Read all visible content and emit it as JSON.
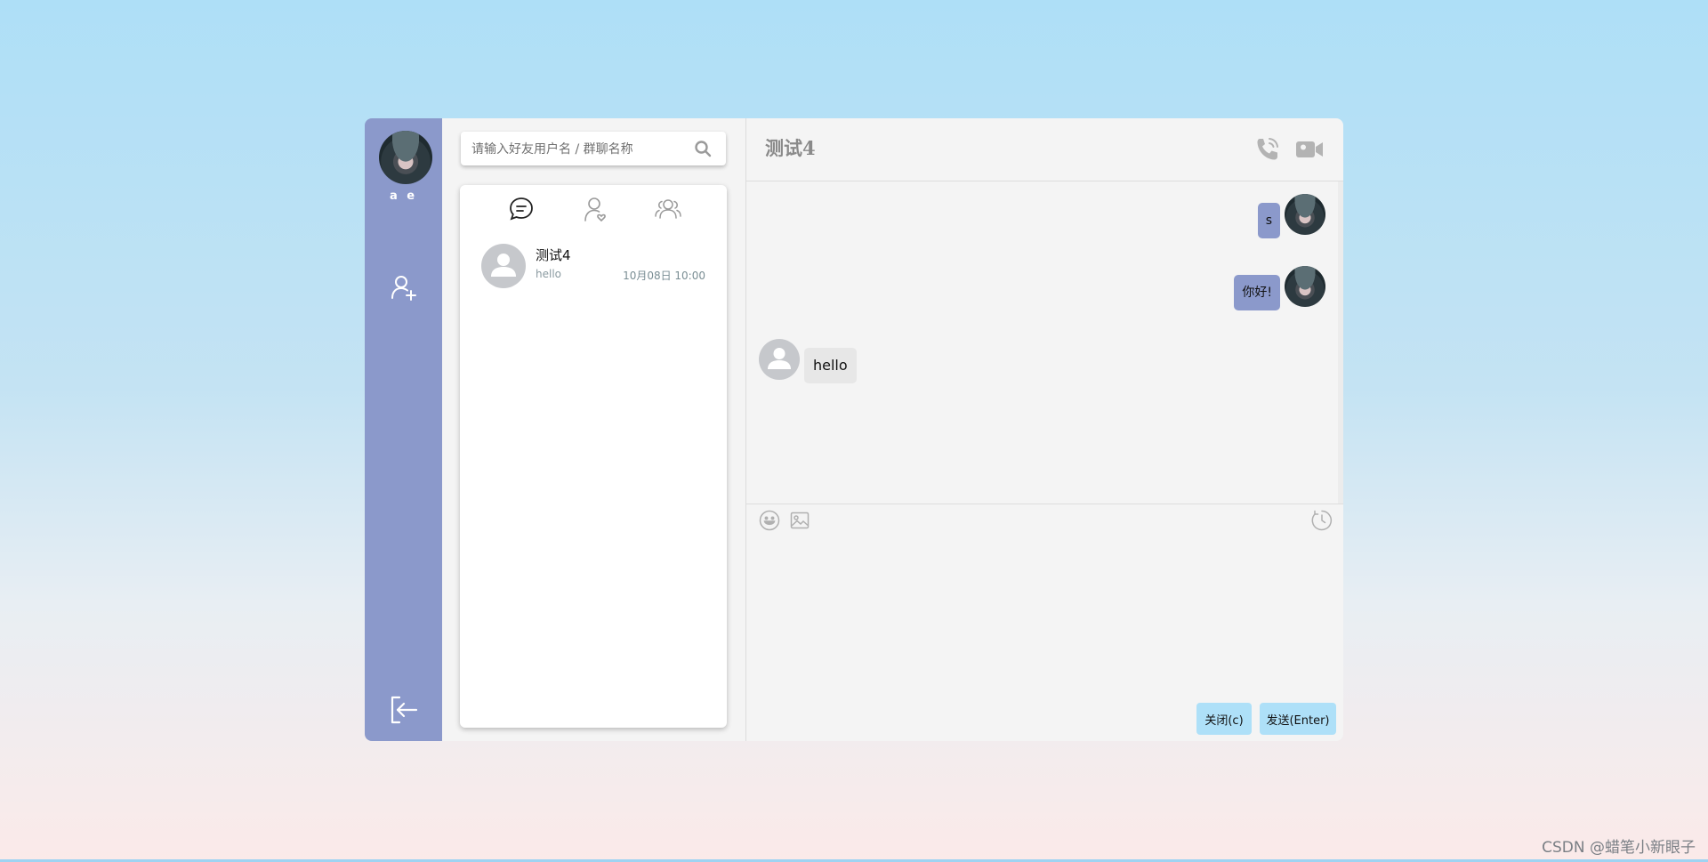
{
  "user": {
    "name": "a e"
  },
  "sidebar": {
    "add_icon": "add-user-icon",
    "logout_icon": "logout-icon"
  },
  "search": {
    "placeholder": "请输入好友用户名 / 群聊名称",
    "icon": "search-icon"
  },
  "tabs": [
    {
      "icon": "chat-icon",
      "active": true
    },
    {
      "icon": "friends-icon",
      "active": false
    },
    {
      "icon": "groups-icon",
      "active": false
    }
  ],
  "contacts": [
    {
      "name": "测试4",
      "last_message": "hello",
      "time": "10月08日 10:00"
    }
  ],
  "chat": {
    "title": "测试4",
    "messages": [
      {
        "from": "me",
        "text": "s"
      },
      {
        "from": "me",
        "text": "你好!"
      },
      {
        "from": "other",
        "text": "hello"
      }
    ],
    "close_label": "关闭(c)",
    "send_label": "发送(Enter)"
  },
  "colors": {
    "sidebar": "#8b99cb",
    "my_bubble": "#8b99cb",
    "button": "#aee0f8"
  },
  "watermark": "CSDN @蜡笔小新眼子⁡⁡"
}
